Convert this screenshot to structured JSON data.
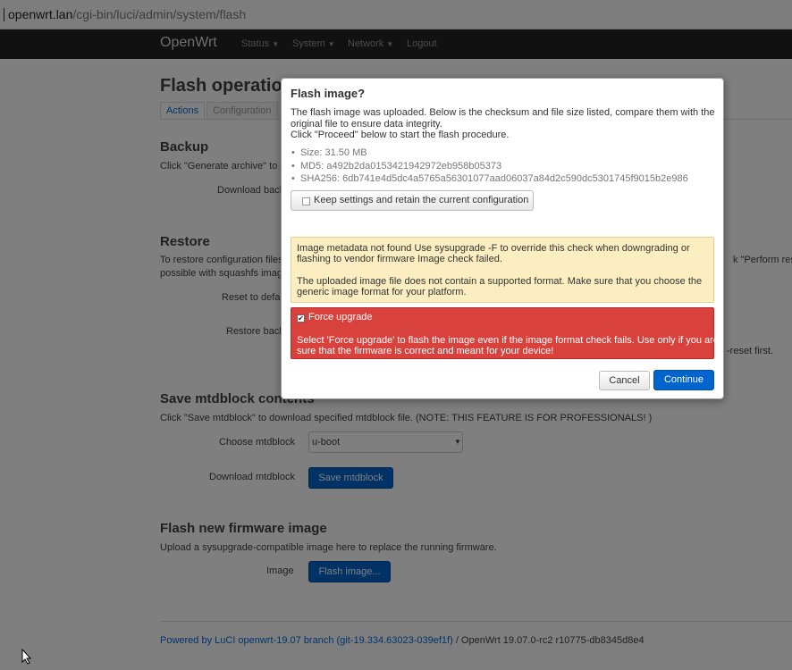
{
  "browser": {
    "url_host": "openwrt.lan",
    "url_path": "/cgi-bin/luci/admin/system/flash"
  },
  "navbar": {
    "brand": "OpenWrt",
    "menus": [
      "Status",
      "System",
      "Network",
      "Logout"
    ]
  },
  "page": {
    "title": "Flash operatio",
    "tabs": [
      "Actions",
      "Configuration"
    ],
    "backup": {
      "heading": "Backup",
      "desc": "Click \"Generate archive\" to d",
      "download_label": "Download back"
    },
    "restore": {
      "heading": "Restore",
      "desc1": "To restore configuration files",
      "desc2": "possible with squashfs image",
      "desc_right": "k \"Perform reset",
      "reset_label": "Reset to defau",
      "restore_label": "Restore back",
      "note_right": "-reset first."
    },
    "mtd": {
      "heading": "Save mtdblock contents",
      "desc": "Click \"Save mtdblock\" to download specified mtdblock file. (NOTE: THIS FEATURE IS FOR PROFESSIONALS! )",
      "choose_label": "Choose mtdblock",
      "choose_value": "u-boot",
      "download_label": "Download mtdblock",
      "save_button": "Save mtdblock"
    },
    "flash": {
      "heading": "Flash new firmware image",
      "desc": "Upload a sysupgrade-compatible image here to replace the running firmware.",
      "image_label": "Image",
      "flash_button": "Flash image..."
    },
    "footer": {
      "link": "Powered by LuCI openwrt-19.07 branch (git-19.334.63023-039ef1f)",
      "version": " / OpenWrt 19.07.0-rc2 r10775-db8345d8e4"
    }
  },
  "modal": {
    "title": "Flash image?",
    "text1": "The flash image was uploaded. Below is the checksum and file size listed, compare them with the",
    "text2": "original file to ensure data integrity.",
    "text3": "Click \"Proceed\" below to start the flash procedure.",
    "size": "Size: 31.50 MB",
    "md5": "MD5: a492b2da0153421942972eb958b05373",
    "sha256": "SHA256: 6db741e4d5dc4a5765a56301077aad06037a84d2c590dc5301745f9015b2e986",
    "keep_label": "Keep settings and retain the current configuration",
    "keep_checked": false,
    "warn1": "Image metadata not found Use sysupgrade -F to override this check when downgrading or",
    "warn2": "flashing to vendor firmware Image check failed.",
    "warn3": "The uploaded image file does not contain a supported format. Make sure that you choose the",
    "warn4": "generic image format for your platform.",
    "force_label": "Force upgrade",
    "force_checked": true,
    "danger1": "Select 'Force upgrade' to flash the image even if the image format check fails. Use only if you are",
    "danger2": "sure that the firmware is correct and meant for your device!",
    "cancel": "Cancel",
    "continue": "Continue"
  },
  "colors": {
    "accent": "#0064cd",
    "danger": "#d9413d",
    "warning": "#fceec1",
    "navbar": "#222222"
  },
  "icons": [
    "checkbox-icon",
    "chevron-down-icon",
    "mouse-pointer-icon"
  ]
}
